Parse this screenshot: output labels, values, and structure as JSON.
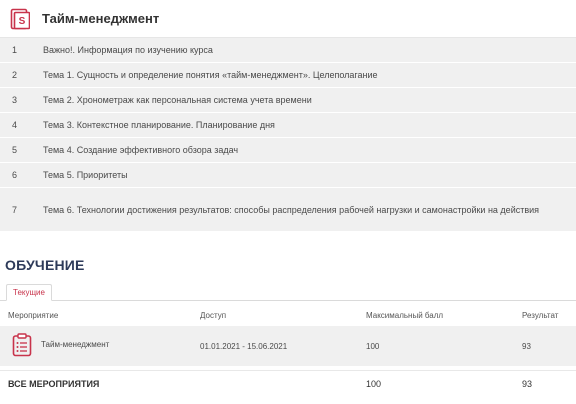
{
  "course": {
    "title": "Тайм-менеджмент",
    "accent_color": "#c8334b",
    "topics": [
      {
        "num": "1",
        "title": "Важно!. Информация по изучению курса"
      },
      {
        "num": "2",
        "title": "Тема 1. Сущность и определение понятия «тайм-менеджмент». Целеполагание"
      },
      {
        "num": "3",
        "title": "Тема 2. Хронометраж как персональная система учета времени"
      },
      {
        "num": "4",
        "title": "Тема 3. Контекстное планирование. Планирование дня"
      },
      {
        "num": "5",
        "title": "Тема 4. Создание эффективного обзора задач"
      },
      {
        "num": "6",
        "title": "Тема 5. Приоритеты"
      },
      {
        "num": "7",
        "title": "Тема 6. Технологии достижения результатов: способы распределения рабочей нагрузки и самонастройки на действия"
      }
    ]
  },
  "learning": {
    "section_title": "ОБУЧЕНИЕ",
    "tab_current": "Текущие",
    "columns": {
      "event": "Мероприятие",
      "access": "Доступ",
      "max_score": "Максимальный балл",
      "result": "Результат"
    },
    "rows": [
      {
        "event": "Тайм-менеджмент",
        "access": "01.01.2021 - 15.06.2021",
        "max_score": "100",
        "result": "93"
      }
    ],
    "total": {
      "label": "ВСЕ МЕРОПРИЯТИЯ",
      "max_score": "100",
      "result": "93"
    }
  }
}
